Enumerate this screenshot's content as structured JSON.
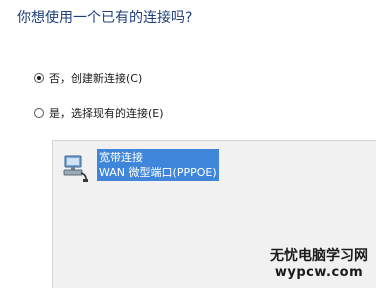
{
  "question": "你想使用一个已有的连接吗?",
  "options": [
    {
      "label": "否，创建新连接(C)",
      "checked": true
    },
    {
      "label": "是，选择现有的连接(E)",
      "checked": false
    }
  ],
  "connections": [
    {
      "name": "宽带连接",
      "detail": "WAN 微型端口(PPPOE)",
      "icon": "network-computer-icon",
      "selected": true
    }
  ],
  "watermark": {
    "line1": "无忧电脑学习网",
    "line2": "wypcw.com"
  },
  "colors": {
    "heading": "#1e3f7a",
    "selection": "#3f86da",
    "panel": "#f1f1f1"
  }
}
